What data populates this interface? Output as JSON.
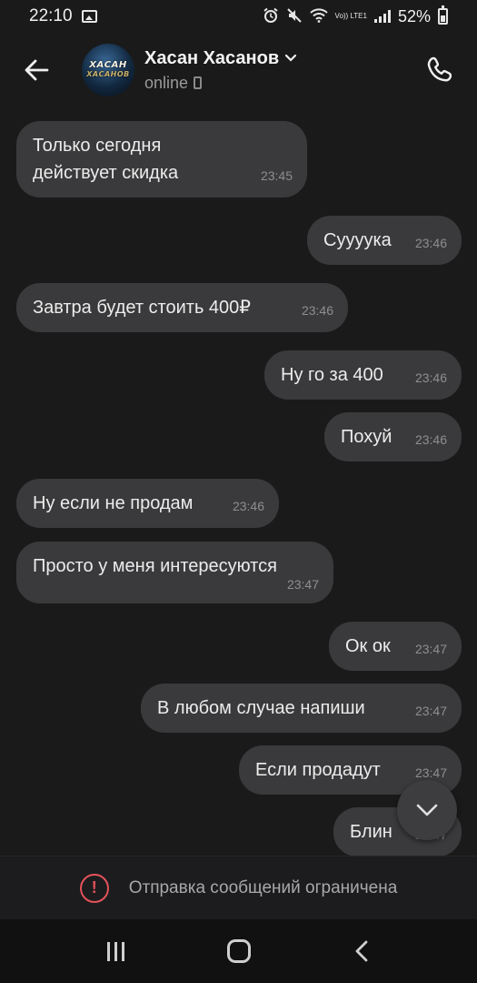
{
  "status_bar": {
    "time": "22:10",
    "battery": "52%",
    "network_label": "Vo)) LTE1",
    "icons": [
      "gallery-icon",
      "alarm-icon",
      "mute-icon",
      "wifi-icon",
      "signal-icon",
      "battery-icon"
    ]
  },
  "header": {
    "contact_name": "Хасан Хасанов",
    "status": "online",
    "avatar_line1": "ХАСАН",
    "avatar_line2": "ХАСАНОВ",
    "icons": [
      "back-arrow-icon",
      "chevron-down-icon",
      "phone-icon",
      "call-icon"
    ]
  },
  "messages": [
    {
      "direction": "in",
      "text": "Только сегодня действует скидка",
      "time": "23:45"
    },
    {
      "direction": "out",
      "text": "Суууука",
      "time": "23:46"
    },
    {
      "direction": "in",
      "text": "Завтра будет стоить 400₽",
      "time": "23:46"
    },
    {
      "direction": "out",
      "text": "Ну го за 400",
      "time": "23:46"
    },
    {
      "direction": "out",
      "text": "Похуй",
      "time": "23:46"
    },
    {
      "direction": "in",
      "text": "Ну если не продам",
      "time": "23:46"
    },
    {
      "direction": "in",
      "text": "Просто у меня интересуются",
      "time": "23:47"
    },
    {
      "direction": "out",
      "text": "Ок ок",
      "time": "23:47"
    },
    {
      "direction": "out",
      "text": "В любом случае напиши",
      "time": "23:47"
    },
    {
      "direction": "out",
      "text": "Если продадут",
      "time": "23:47"
    },
    {
      "direction": "out",
      "text": "Блин",
      "time": "23:47"
    }
  ],
  "scroll_button": {
    "icon": "chevron-down-icon"
  },
  "footer": {
    "restriction_icon_glyph": "!",
    "restriction_text": "Отправка сообщений ограничена"
  },
  "colors": {
    "background": "#1a1a1a",
    "bubble": "#3a3a3c",
    "warning": "#e4525a"
  }
}
